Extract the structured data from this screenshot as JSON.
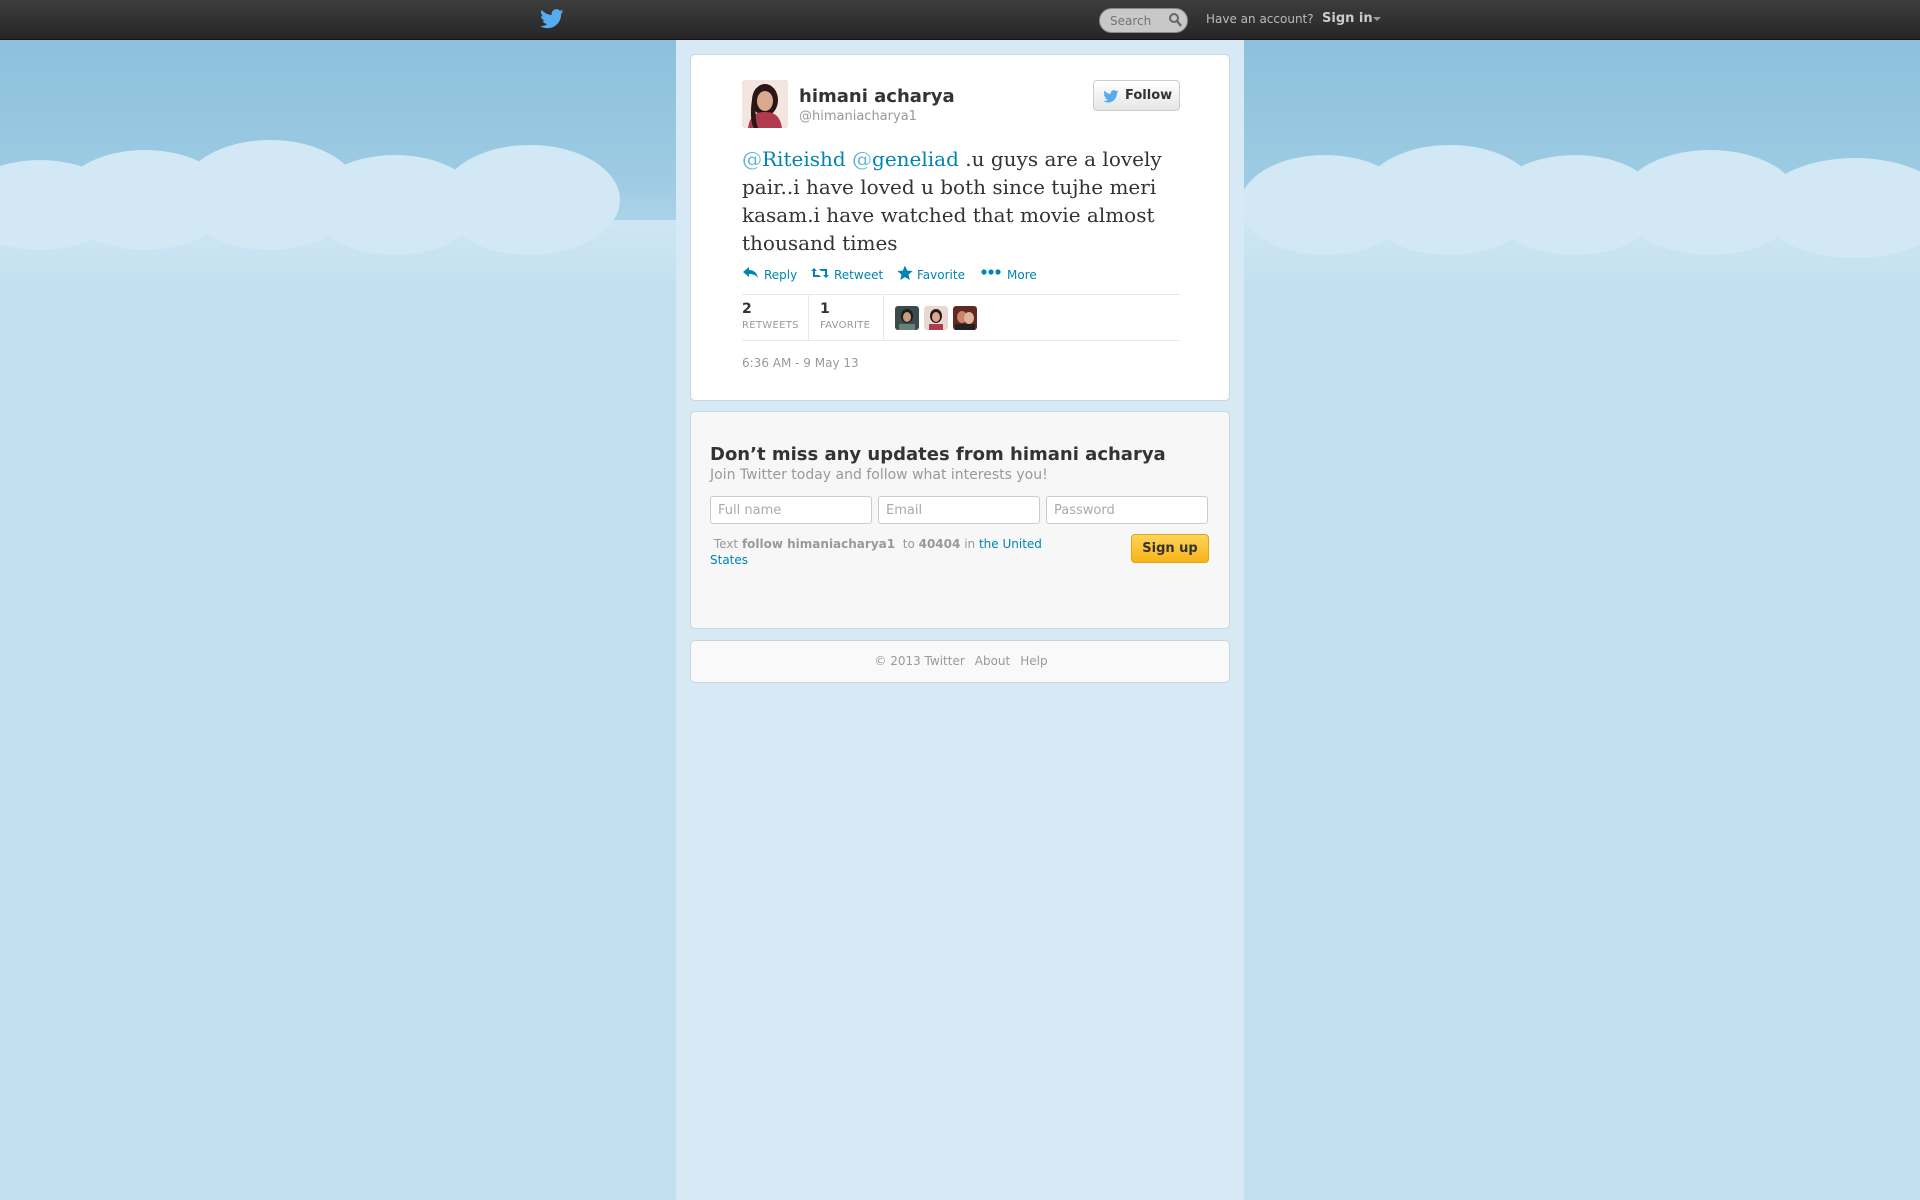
{
  "topbar": {
    "search_placeholder": "Search",
    "have_account": "Have an account?",
    "sign_in": "Sign in"
  },
  "tweet": {
    "author_name": "himani acharya",
    "author_handle": "@himaniacharya1",
    "follow_label": "Follow",
    "mention1_at": "@",
    "mention1_name": "Riteishd",
    "mention2_at": "@",
    "mention2_name": "geneliad",
    "body": " .u guys are a lovely pair..i have loved u both since tujhe meri kasam.i have watched that movie almost thousand times",
    "actions": {
      "reply": "Reply",
      "retweet": "Retweet",
      "favorite": "Favorite",
      "more": "More"
    },
    "stats": {
      "retweets_count": "2",
      "retweets_label": "RETWEETS",
      "favorites_count": "1",
      "favorites_label": "FAVORITE"
    },
    "timestamp": "6:36 AM - 9 May 13"
  },
  "signup": {
    "title": "Don’t miss any updates from himani acharya",
    "subtitle": "Join Twitter today and follow what interests you!",
    "fullname_placeholder": "Full name",
    "email_placeholder": "Email",
    "password_placeholder": "Password",
    "sms_text": "Text",
    "sms_command": "follow himaniacharya1",
    "sms_to": "to",
    "sms_number": "40404",
    "sms_in": "in",
    "sms_country": "the United States",
    "button": "Sign up"
  },
  "footer": {
    "copyright": "© 2013 Twitter",
    "about": "About",
    "help": "Help"
  },
  "colors": {
    "link": "#0084b4",
    "brand": "#55acee",
    "signup_button": "#f7b418"
  }
}
